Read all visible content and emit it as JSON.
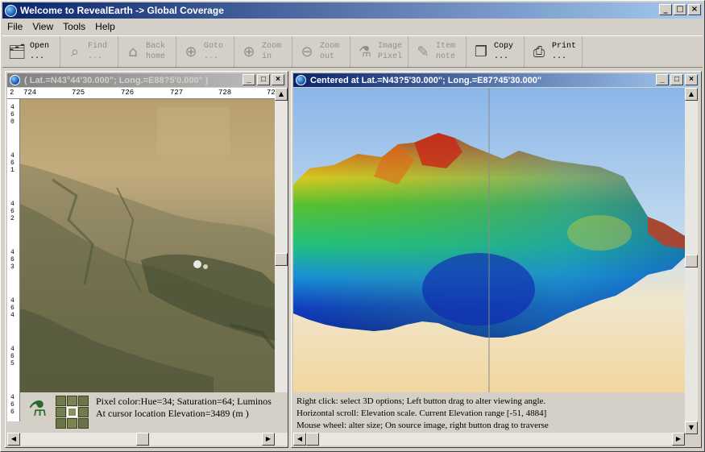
{
  "app": {
    "title": "Welcome to RevealEarth -> Global Coverage"
  },
  "menu": [
    "File",
    "View",
    "Tools",
    "Help"
  ],
  "toolbar": [
    {
      "label": "Open\n...",
      "icon": "open-icon",
      "enabled": true
    },
    {
      "label": "Find\n...",
      "icon": "binoculars-icon",
      "enabled": false
    },
    {
      "label": "Back\nhome",
      "icon": "home-icon",
      "enabled": false
    },
    {
      "label": "Goto\n...",
      "icon": "compass-icon",
      "enabled": false
    },
    {
      "label": "Zoom\nin",
      "icon": "zoom-in-icon",
      "enabled": false
    },
    {
      "label": "Zoom\nout",
      "icon": "zoom-out-icon",
      "enabled": false
    },
    {
      "label": "Image\nPixel",
      "icon": "microscope-icon",
      "enabled": false
    },
    {
      "label": "Item\nnote",
      "icon": "note-icon",
      "enabled": false
    },
    {
      "label": "Copy\n...",
      "icon": "copy-icon",
      "enabled": true
    },
    {
      "label": "Print\n...",
      "icon": "printer-icon",
      "enabled": true
    }
  ],
  "left_window": {
    "title": "( Lat.=N43°44'30.000\"; Long.=E88?5'0.000\" )",
    "ruler_top": [
      "2",
      "724",
      "725",
      "726",
      "727",
      "728",
      "729"
    ],
    "ruler_left": [
      "4\n6\n0",
      "4\n6\n1",
      "4\n6\n2",
      "4\n6\n3",
      "4\n6\n4",
      "4\n6\n5",
      "4\n6\n6"
    ],
    "pixel_info": "Pixel color:Hue=34;  Saturation=64;  Luminos",
    "elevation_info": "At cursor location Elevation=3489 (m )"
  },
  "right_window": {
    "title": "Centered at Lat.=N43?5'30.000\"; Long.=E87?45'30.000\"",
    "help_lines": [
      "Right click: select 3D options; Left button drag to alter viewing angle.",
      "Horizontal scroll: Elevation scale. Current Elevation range [-51, 4884]",
      "Mouse wheel: alter size; On source image, right button drag to traverse"
    ]
  },
  "window_buttons": {
    "minimize": "_",
    "maximize": "□",
    "close": "×"
  }
}
